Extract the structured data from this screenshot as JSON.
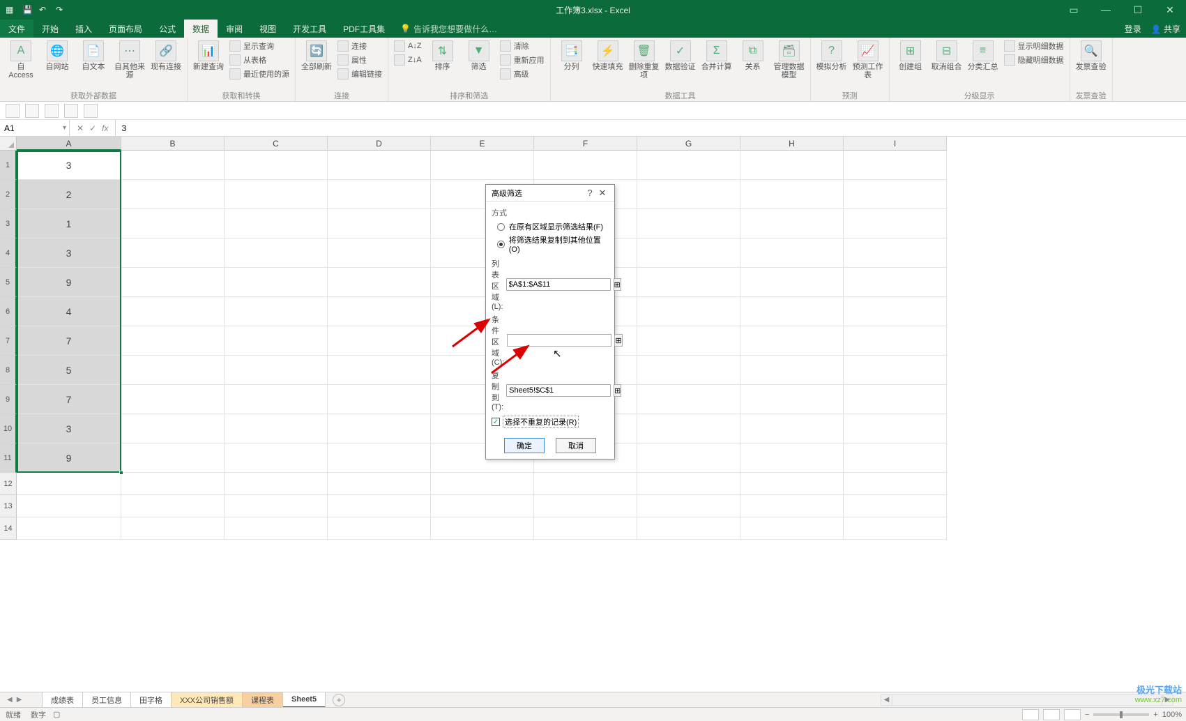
{
  "title": "工作簿3.xlsx - Excel",
  "menu": {
    "file": "文件",
    "tabs": [
      "开始",
      "插入",
      "页面布局",
      "公式",
      "数据",
      "审阅",
      "视图",
      "开发工具",
      "PDF工具集"
    ],
    "active_index": 4,
    "tellme": "告诉我您想要做什么…",
    "login": "登录",
    "share": "共享"
  },
  "ribbon": {
    "groups": [
      {
        "label": "获取外部数据",
        "items": [
          "自 Access",
          "自网站",
          "自文本",
          "自其他来源",
          "现有连接"
        ]
      },
      {
        "label": "获取和转换",
        "items": [
          "新建查询"
        ],
        "sub": [
          "显示查询",
          "从表格",
          "最近使用的源"
        ]
      },
      {
        "label": "连接",
        "items": [
          "全部刷新"
        ],
        "sub": [
          "连接",
          "属性",
          "编辑链接"
        ]
      },
      {
        "label": "排序和筛选",
        "items": [
          "排序",
          "筛选"
        ],
        "sort": [
          "A↓Z",
          "Z↓A"
        ],
        "sub": [
          "清除",
          "重新应用",
          "高级"
        ]
      },
      {
        "label": "数据工具",
        "items": [
          "分列",
          "快速填充",
          "删除重复项",
          "数据验证",
          "合并计算",
          "关系",
          "管理数据模型"
        ]
      },
      {
        "label": "预测",
        "items": [
          "模拟分析",
          "预测工作表"
        ]
      },
      {
        "label": "分级显示",
        "items": [
          "创建组",
          "取消组合",
          "分类汇总"
        ],
        "sub": [
          "显示明细数据",
          "隐藏明细数据"
        ]
      },
      {
        "label": "发票查验",
        "items": [
          "发票查验"
        ]
      }
    ]
  },
  "namebox": "A1",
  "formula": "3",
  "columns": [
    "A",
    "B",
    "C",
    "D",
    "E",
    "F",
    "G",
    "H",
    "I"
  ],
  "rows_data": [
    "3",
    "2",
    "1",
    "3",
    "9",
    "4",
    "7",
    "5",
    "7",
    "3",
    "9"
  ],
  "extra_rows": [
    12,
    13,
    14
  ],
  "dialog": {
    "title": "高级筛选",
    "section": "方式",
    "opt1": "在原有区域显示筛选结果(F)",
    "opt2": "将筛选结果复制到其他位置(O)",
    "list_label": "列表区域(L):",
    "list_val": "$A$1:$A$11",
    "cond_label": "条件区域(C):",
    "cond_val": "",
    "copy_label": "复制到(T):",
    "copy_val": "Sheet5!$C$1",
    "unique": "选择不重复的记录(R)",
    "ok": "确定",
    "cancel": "取消"
  },
  "sheets": [
    "成绩表",
    "员工信息",
    "田字格",
    "XXX公司销售额",
    "课程表",
    "Sheet5"
  ],
  "active_sheet_index": 5,
  "status": {
    "ready": "就绪",
    "count_lbl": "数字"
  },
  "zoom": "100%",
  "watermark": {
    "l1": "极光下载站",
    "l2": "www.xz7.com"
  }
}
